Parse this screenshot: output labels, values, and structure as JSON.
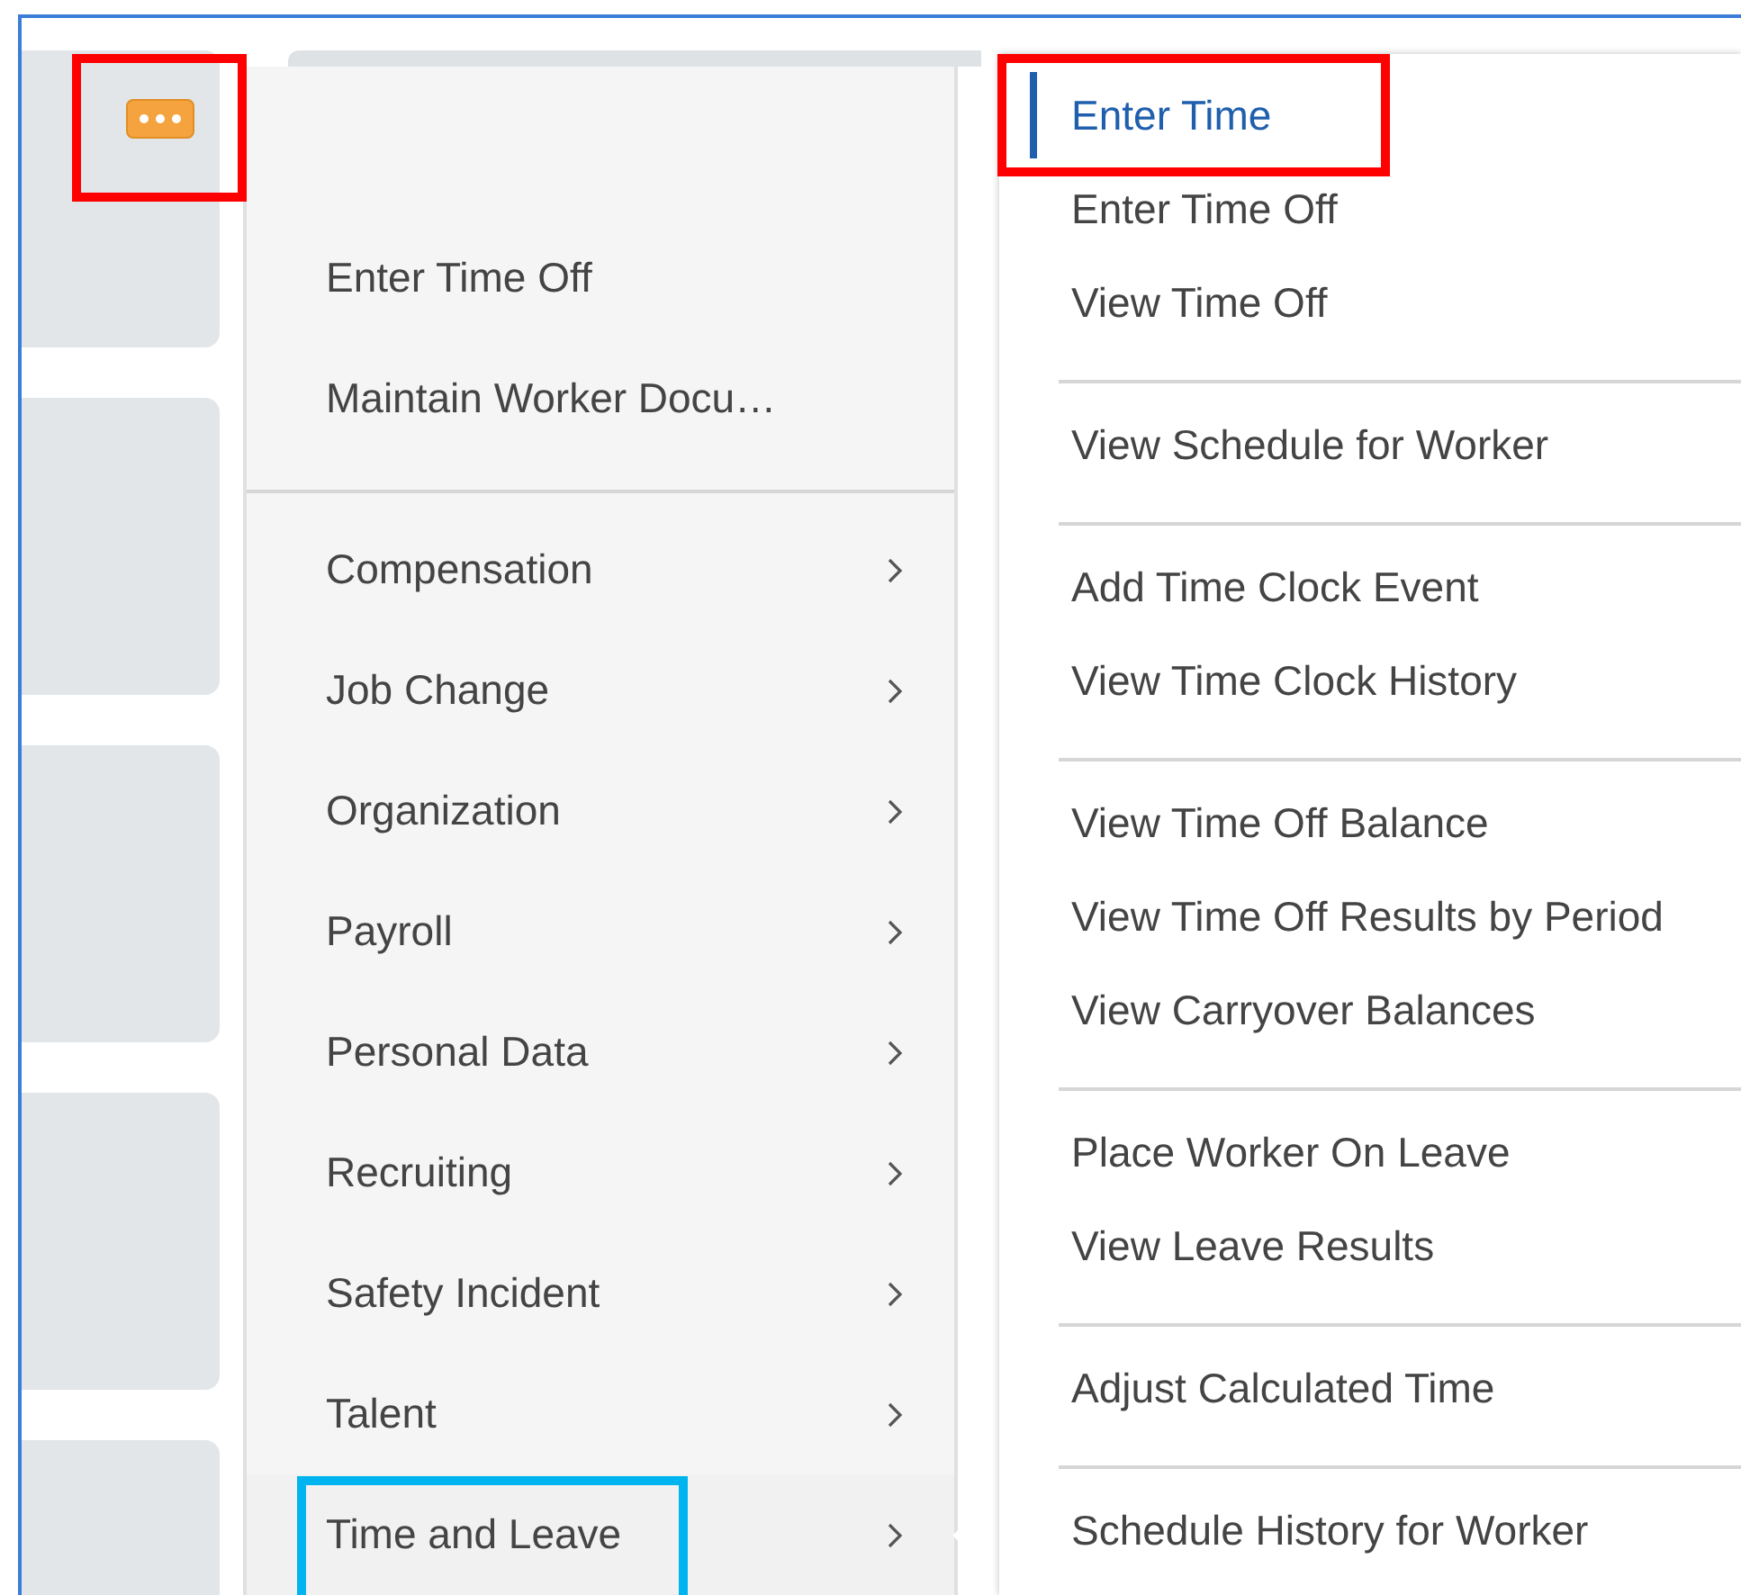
{
  "more_button": {
    "frame": {
      "color": "#ff0000"
    }
  },
  "menu": {
    "sections": [
      {
        "items": [
          {
            "label": "Enter Time Off",
            "kind": "action"
          },
          {
            "label": "Maintain Worker Docu…",
            "kind": "action"
          }
        ]
      },
      {
        "items": [
          {
            "label": "Compensation",
            "kind": "submenu",
            "selected": false
          },
          {
            "label": "Job Change",
            "kind": "submenu",
            "selected": false
          },
          {
            "label": "Organization",
            "kind": "submenu",
            "selected": false
          },
          {
            "label": "Payroll",
            "kind": "submenu",
            "selected": false
          },
          {
            "label": "Personal Data",
            "kind": "submenu",
            "selected": false
          },
          {
            "label": "Recruiting",
            "kind": "submenu",
            "selected": false
          },
          {
            "label": "Safety Incident",
            "kind": "submenu",
            "selected": false
          },
          {
            "label": "Talent",
            "kind": "submenu",
            "selected": false
          },
          {
            "label": "Time and Leave",
            "kind": "submenu",
            "selected": true,
            "frame": {
              "color": "#00b4ef"
            }
          }
        ]
      }
    ]
  },
  "submenu": {
    "groups": [
      {
        "items": [
          {
            "label": "Enter Time",
            "selected": true,
            "frame": {
              "color": "#ff0000"
            }
          },
          {
            "label": "Enter Time Off",
            "selected": false
          },
          {
            "label": "View Time Off",
            "selected": false
          }
        ]
      },
      {
        "items": [
          {
            "label": "View Schedule for Worker",
            "selected": false
          }
        ]
      },
      {
        "items": [
          {
            "label": "Add Time Clock Event",
            "selected": false
          },
          {
            "label": "View Time Clock History",
            "selected": false
          }
        ]
      },
      {
        "items": [
          {
            "label": "View Time Off Balance",
            "selected": false
          },
          {
            "label": "View Time Off Results by Period",
            "selected": false
          },
          {
            "label": "View Carryover Balances",
            "selected": false
          }
        ]
      },
      {
        "items": [
          {
            "label": "Place Worker On Leave",
            "selected": false
          },
          {
            "label": "View Leave Results",
            "selected": false
          }
        ]
      },
      {
        "items": [
          {
            "label": "Adjust Calculated Time",
            "selected": false
          }
        ]
      },
      {
        "items": [
          {
            "label": "Schedule History for Worker",
            "selected": false
          }
        ]
      }
    ]
  }
}
